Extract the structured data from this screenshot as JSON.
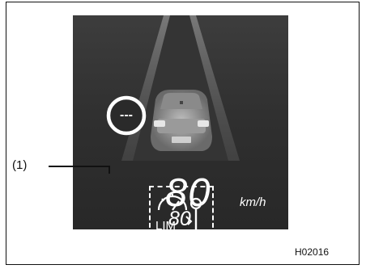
{
  "callout": {
    "label": "(1)"
  },
  "speed": {
    "current": "80",
    "set": "80",
    "unit": "km/h"
  },
  "sign": {
    "text": "---"
  },
  "indicator": {
    "text": "LIM",
    "icon": "speed-limiter-icon"
  },
  "figure": {
    "code": "H02016"
  },
  "colors": {
    "display_bg": "#2a2a2a",
    "text": "#ffffff",
    "frame": "#111111"
  }
}
